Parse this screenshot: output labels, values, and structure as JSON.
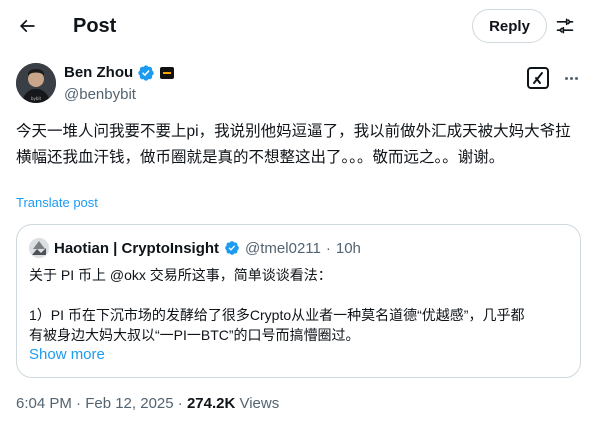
{
  "header": {
    "title": "Post",
    "reply_label": "Reply"
  },
  "icons": {
    "back": "arrow-left-icon",
    "adjust": "sliders-icon",
    "verified": "verified-badge-icon",
    "affiliate": "affiliate-badge-icon",
    "grok": "grok-icon",
    "more": "more-icon",
    "accent_color": "#1d9bf0"
  },
  "post": {
    "author_name": "Ben Zhou",
    "author_handle": "@benbybit",
    "text": "今天一堆人问我要不要上pi，我说别他妈逗逼了，我以前做外汇成天被大妈大爷拉横幅还我血汗钱，做币圈就是真的不想整这出了。。。敬而远之。。谢谢。",
    "translate_label": "Translate post",
    "time": "6:04 PM · Feb 12, 2025",
    "separator": " · ",
    "views_count": "274.2K",
    "views_label": " Views"
  },
  "quote": {
    "name": "Haotian | CryptoInsight",
    "handle": "@tmel0211",
    "dot": "·",
    "time": "10h",
    "line1": "关于 PI 币上 @okx 交易所这事，简单谈谈看法：",
    "line2": "1）PI 币在下沉市场的发酵给了很多Crypto从业者一种莫名道德“优越感”，几乎都",
    "line3": "有被身边大妈大叔以“一PI一BTC”的口号而搞懵圈过。",
    "show_more": "Show more"
  }
}
